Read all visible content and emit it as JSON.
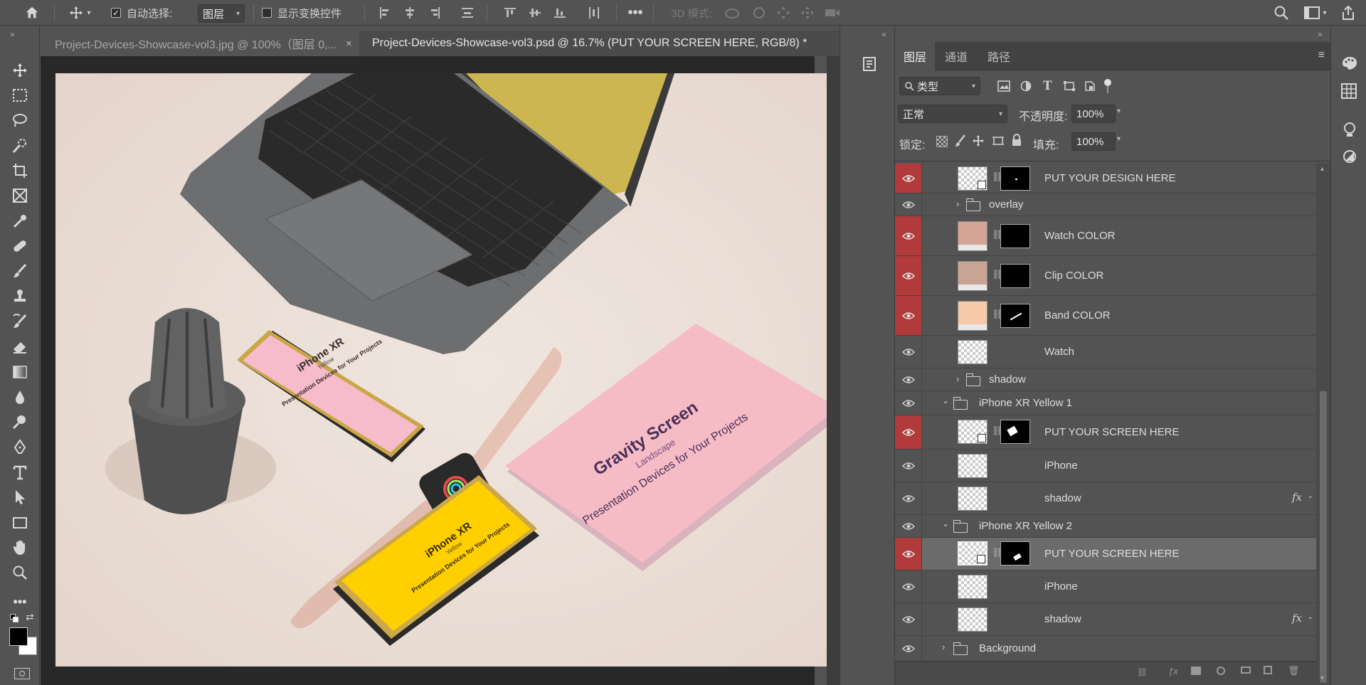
{
  "options_bar": {
    "auto_select_label": "自动选择:",
    "auto_select_value": "图层",
    "show_transform_label": "显示变换控件",
    "mode3d_label": "3D 模式:"
  },
  "tabs": [
    {
      "label": "Project-Devices-Showcase-vol3.jpg  @  100%（图层 0,...",
      "close": "×"
    },
    {
      "label": "Project-Devices-Showcase-vol3.psd @ 16.7% (PUT YOUR SCREEN HERE, RGB/8) *",
      "close": "×"
    }
  ],
  "panel": {
    "tabs": [
      "图层",
      "通道",
      "路径"
    ],
    "filter_label": "类型",
    "blend_mode": "正常",
    "opacity_label": "不透明度:",
    "opacity_value": "100%",
    "lock_label": "锁定:",
    "fill_label": "填充:",
    "fill_value": "100%"
  },
  "layers": [
    {
      "name": "PUT YOUR DESIGN HERE",
      "kind": "smart",
      "red": true,
      "mask": true
    },
    {
      "name": "overlay",
      "kind": "group-closed",
      "red": false
    },
    {
      "name": "Watch COLOR",
      "kind": "fill",
      "color": "#d4a497",
      "red": true,
      "mask": true
    },
    {
      "name": "Clip COLOR",
      "kind": "fill",
      "color": "#c9a394",
      "red": true,
      "mask": true
    },
    {
      "name": "Band COLOR",
      "kind": "fill",
      "color": "#f6c9a8",
      "red": true,
      "mask": true
    },
    {
      "name": "Watch",
      "kind": "pixel",
      "red": false
    },
    {
      "name": "shadow",
      "kind": "group-closed",
      "red": false
    },
    {
      "name": "iPhone XR Yellow 1",
      "kind": "group-open",
      "red": false
    },
    {
      "name": "PUT YOUR SCREEN HERE",
      "kind": "smart",
      "red": true,
      "mask": true
    },
    {
      "name": "iPhone",
      "kind": "pixel",
      "red": false
    },
    {
      "name": "shadow",
      "kind": "pixel",
      "red": false,
      "fx": "fx"
    },
    {
      "name": "iPhone XR Yellow 2",
      "kind": "group-open",
      "red": false
    },
    {
      "name": "PUT YOUR SCREEN HERE",
      "kind": "smart",
      "red": true,
      "mask": true,
      "selected": true
    },
    {
      "name": "iPhone",
      "kind": "pixel",
      "red": false
    },
    {
      "name": "shadow",
      "kind": "pixel",
      "red": false,
      "fx": "fx"
    },
    {
      "name": "Background",
      "kind": "group-closed",
      "red": false
    }
  ],
  "canvas": {
    "phone_pink_title": "iPhone XR",
    "phone_pink_sub": "Yellow",
    "phone_pink_body": "Presentation Devices for Your Projects",
    "phone_yellow_title": "iPhone XR",
    "phone_yellow_sub": "Yellow",
    "phone_yellow_body": "Presentation Devices for Your Projects",
    "tablet_title": "Gravity Screen",
    "tablet_sub": "Landscape",
    "tablet_body": "Presentation Devices for Your Projects"
  }
}
